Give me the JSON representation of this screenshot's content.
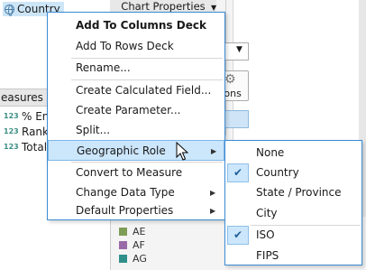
{
  "data_pane": {
    "selected_field": "Country",
    "measures_header": "easures",
    "measures": [
      {
        "type_icon": "123",
        "label": "% Eng"
      },
      {
        "type_icon": "123",
        "label": "Rank"
      },
      {
        "type_icon": "123",
        "label": "Total"
      }
    ]
  },
  "right_pane": {
    "chart_properties_tab": "Chart Properties",
    "options_button_label": "tions",
    "legend": [
      {
        "label": "AE",
        "color": "#7f9c55"
      },
      {
        "label": "AF",
        "color": "#9a6aa8"
      },
      {
        "label": "AG",
        "color": "#2f8f8a"
      }
    ]
  },
  "context_menu": {
    "items": [
      {
        "label": "Add To Columns Deck",
        "bold": true
      },
      {
        "label": "Add To Rows Deck"
      },
      {
        "label": "Rename..."
      },
      {
        "label": "Create Calculated Field..."
      },
      {
        "label": "Create Parameter..."
      },
      {
        "label": "Split..."
      },
      {
        "label": "Geographic Role",
        "submenu": true,
        "highlighted": true
      },
      {
        "label": "Convert to Measure"
      },
      {
        "label": "Change Data Type",
        "submenu": true
      },
      {
        "label": "Default Properties",
        "submenu": true
      }
    ]
  },
  "geographic_role_submenu": {
    "items": [
      {
        "label": "None",
        "checked": false
      },
      {
        "label": "Country",
        "checked": true
      },
      {
        "label": "State / Province",
        "checked": false
      },
      {
        "label": "City",
        "checked": false
      },
      {
        "label": "ISO",
        "checked": true
      },
      {
        "label": "FIPS",
        "checked": false
      }
    ]
  },
  "icons": {
    "field_type": "globe-icon",
    "submenu_arrow": "chevron-right-icon",
    "check": "checkmark-icon",
    "settings": "gear-icon"
  },
  "colors": {
    "menu_border": "#3b8cd3",
    "highlight": "#cce6fb",
    "field_selection": "#cde6f7"
  }
}
